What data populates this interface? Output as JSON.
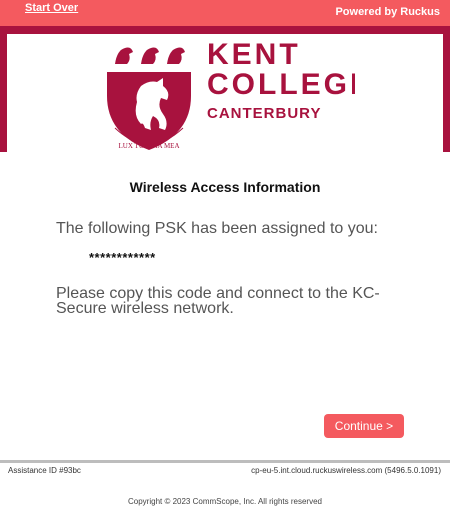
{
  "header": {
    "start_over_label": "Start Over",
    "powered_by": "Powered by Ruckus"
  },
  "logo": {
    "line1": "KENT",
    "line2": "COLLEGE",
    "line3": "CANTERBURY",
    "motto": "LUX TUA VIA MEA"
  },
  "main": {
    "heading": "Wireless Access Information",
    "psk_intro": "The following PSK has been assigned to you:",
    "psk_value": "************",
    "instructions": "Please copy this code and connect to the KC-Secure wireless network.",
    "continue_label": "Continue >"
  },
  "footer": {
    "assistance_id": "Assistance ID #93bc",
    "server": "cp-eu-5.int.cloud.ruckuswireless.com (5496.5.0.1091)",
    "copyright": "Copyright © 2023 CommScope, Inc. All rights reserved"
  },
  "colors": {
    "accent": "#f45a5f",
    "brand": "#a8123e"
  }
}
